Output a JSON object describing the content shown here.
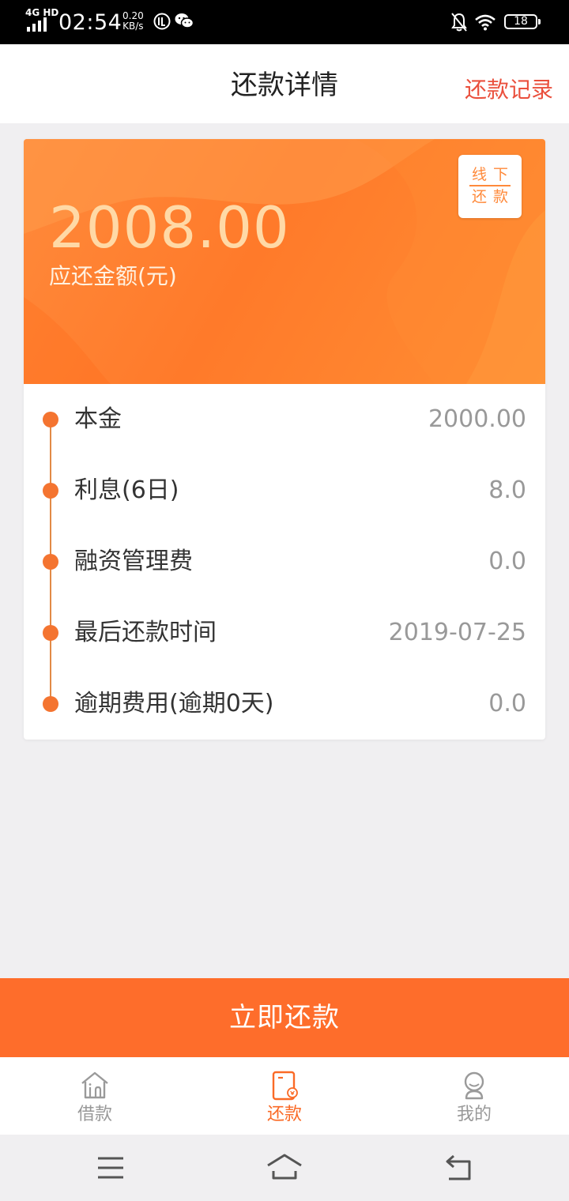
{
  "status_bar": {
    "network": "4G HD",
    "time": "02:54",
    "speed_value": "0.20",
    "speed_unit": "KB/s",
    "battery": "18"
  },
  "header": {
    "title": "还款详情",
    "right_link": "还款记录"
  },
  "summary": {
    "amount": "2008.00",
    "amount_label": "应还金额(元)",
    "offline_line1": "线下",
    "offline_line2": "还款"
  },
  "details": [
    {
      "label": "本金",
      "value": "2000.00"
    },
    {
      "label": "利息(6日)",
      "value": "8.0"
    },
    {
      "label": "融资管理费",
      "value": "0.0"
    },
    {
      "label": "最后还款时间",
      "value": "2019-07-25"
    },
    {
      "label": "逾期费用(逾期0天)",
      "value": "0.0"
    }
  ],
  "pay_button": "立即还款",
  "tabs": [
    {
      "label": "借款",
      "icon": "home-icon",
      "active": false
    },
    {
      "label": "还款",
      "icon": "repay-icon",
      "active": true
    },
    {
      "label": "我的",
      "icon": "profile-icon",
      "active": false
    }
  ],
  "colors": {
    "accent": "#fe6d2b",
    "link": "#ea4f3c",
    "amount_text": "#ffd9a6"
  }
}
